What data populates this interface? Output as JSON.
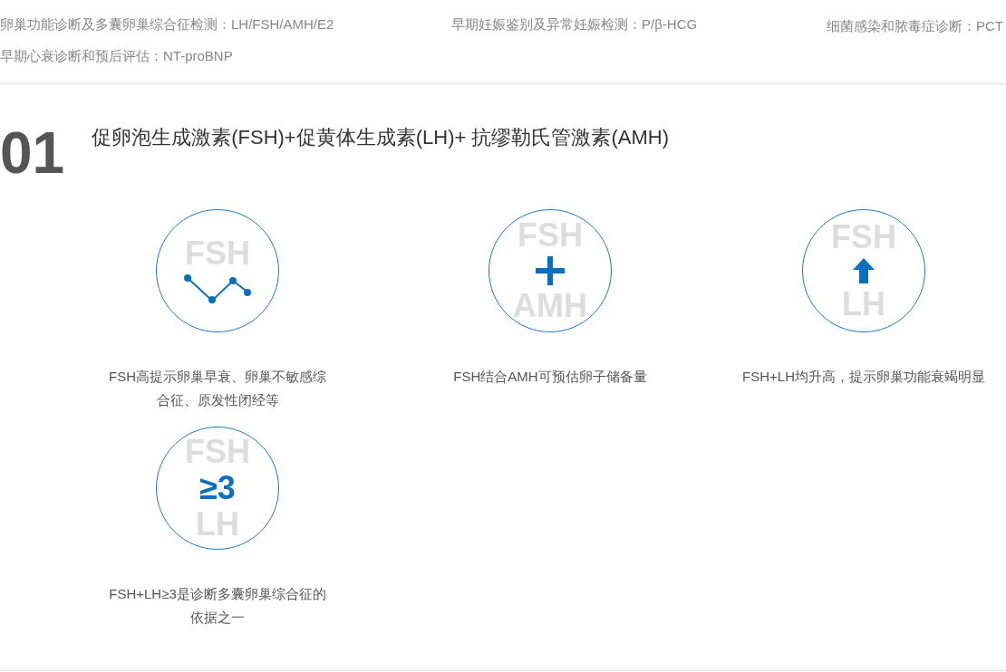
{
  "top_links": [
    {
      "label": "卵巢功能诊断及多囊卵巢综合征检测：LH/FSH/AMH/E2"
    },
    {
      "label": "早期妊娠鉴别及异常妊娠检测：P/β-HCG"
    },
    {
      "label": "细菌感染和脓毒症诊断：PCT"
    },
    {
      "label": "早期心衰诊断和预后评估：NT-proBNP"
    }
  ],
  "section": {
    "number": "01",
    "title": "促卵泡生成激素(FSH)+促黄体生成素(LH)+ 抗缪勒氏管激素(AMH)"
  },
  "cards": [
    {
      "kind": "chart",
      "top": "FSH",
      "caption": "FSH高提示卵巢早衰、卵巢不敏感综合征、原发性闭经等"
    },
    {
      "kind": "plus",
      "top": "FSH",
      "bottom": "AMH",
      "caption": "FSH结合AMH可预估卵子储备量"
    },
    {
      "kind": "arrow",
      "top": "FSH",
      "bottom": "LH",
      "caption": "FSH+LH均升高，提示卵巢功能衰竭明显"
    },
    {
      "kind": "ratio",
      "top": "FSH",
      "middle": "≥3",
      "bottom": "LH",
      "caption": "FSH+LH≥3是诊断多囊卵巢综合征的依据之一"
    }
  ]
}
